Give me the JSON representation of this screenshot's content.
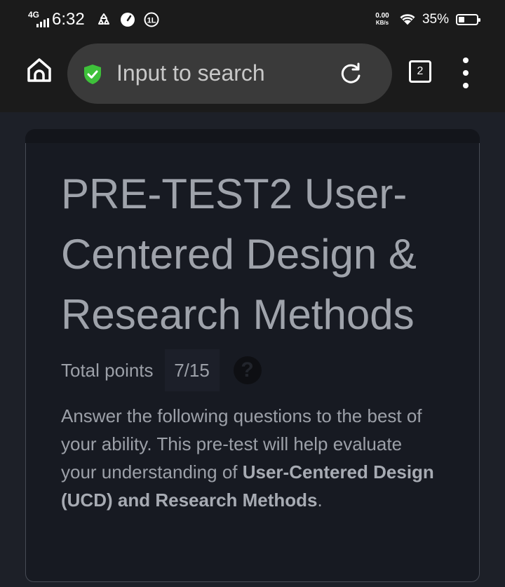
{
  "status_bar": {
    "network": "4G",
    "time": "6:32",
    "net_speed_value": "0.00",
    "net_speed_unit": "KB/s",
    "battery_percent": "35%",
    "battery_level": 0.35,
    "icons": [
      "recycle-icon",
      "speedometer-icon",
      "one-l-icon",
      "wifi-icon",
      "battery-icon"
    ]
  },
  "browser": {
    "search_placeholder": "Input to search",
    "tab_count": "2",
    "icons": [
      "home-icon",
      "shield-check-icon",
      "reload-icon",
      "tabs-icon",
      "more-vert-icon"
    ],
    "shield_color": "#3ec13a"
  },
  "form": {
    "title": "PRE-TEST2 User-Centered Design & Research Methods",
    "total_points_label": "Total points",
    "total_points_value": "7/15",
    "help_icon": "question-mark-icon",
    "description_part1": " Answer the following questions to the best of your ability. This pre-test will help evaluate your understanding of ",
    "description_bold1": "User-Centered Design (UCD)",
    "description_part2": " and ",
    "description_bold2": "Research Methods",
    "description_part3": "."
  }
}
